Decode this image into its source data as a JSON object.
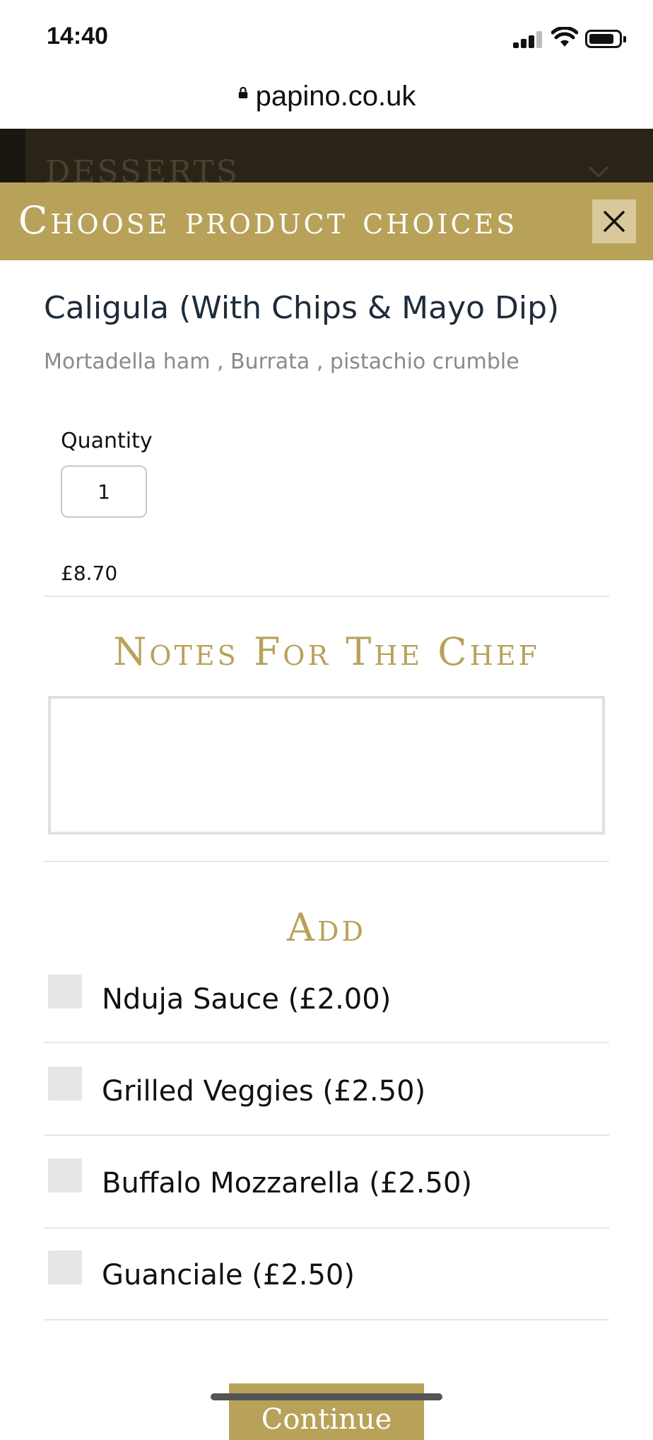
{
  "status_bar": {
    "time": "14:40"
  },
  "browser": {
    "url": "papino.co.uk"
  },
  "background_page": {
    "section_label": "DESSERTS"
  },
  "modal": {
    "title": "Choose product choices",
    "product": {
      "name": "Caligula (With Chips & Mayo Dip)",
      "description": "Mortadella ham , Burrata , pistachio crumble"
    },
    "quantity": {
      "label": "Quantity",
      "value": "1"
    },
    "price": "£8.70",
    "notes": {
      "title": "Notes For The Chef",
      "value": ""
    },
    "add": {
      "title": "Add",
      "options": [
        {
          "label": "Nduja Sauce (£2.00)",
          "checked": false
        },
        {
          "label": "Grilled Veggies (£2.50)",
          "checked": false
        },
        {
          "label": "Buffalo Mozzarella (£2.50)",
          "checked": false
        },
        {
          "label": "Guanciale (£2.50)",
          "checked": false
        }
      ]
    },
    "continue_label": "Continue"
  },
  "colors": {
    "accent": "#b8a25a",
    "close_bg": "#d9c99a",
    "dark_bg": "#2a2418"
  }
}
